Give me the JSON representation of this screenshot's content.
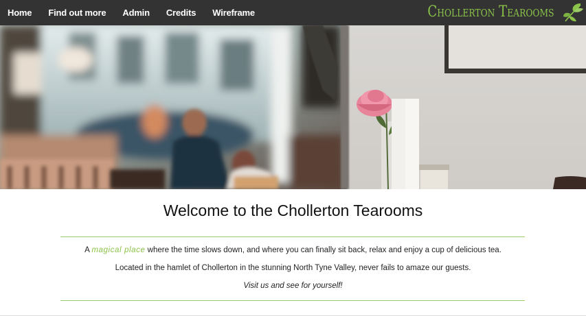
{
  "nav": {
    "items": [
      {
        "label": "Home"
      },
      {
        "label": "Find out more"
      },
      {
        "label": "Admin"
      },
      {
        "label": "Credits"
      },
      {
        "label": "Wireframe"
      }
    ],
    "brand": "Chollerton Tearooms",
    "brand_icon": "leaf-icon"
  },
  "hero": {
    "image": "blurred-tearoom-interior-with-pink-rose"
  },
  "main": {
    "title": "Welcome to the Chollerton Tearooms",
    "para1_prefix": "A ",
    "para1_highlight": "magical place",
    "para1_suffix": " where the time slows down, and where you can finally sit back, relax and enjoy a cup of delicious tea.",
    "para2": "Located in the hamlet of Chollerton in the stunning North Tyne Valley, never fails to amaze our guests.",
    "para3": "Visit us and see for yourself!"
  },
  "colors": {
    "nav_bg": "#333333",
    "accent": "#8bc34a",
    "rule": "#9ccc65"
  }
}
